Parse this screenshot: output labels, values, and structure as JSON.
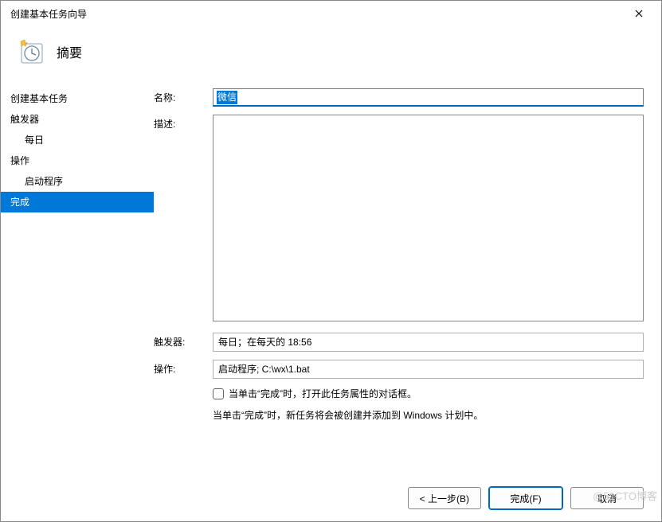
{
  "window": {
    "title": "创建基本任务向导"
  },
  "header": {
    "title": "摘要"
  },
  "sidebar": {
    "items": [
      {
        "label": "创建基本任务",
        "sub": false,
        "selected": false
      },
      {
        "label": "触发器",
        "sub": false,
        "selected": false
      },
      {
        "label": "每日",
        "sub": true,
        "selected": false
      },
      {
        "label": "操作",
        "sub": false,
        "selected": false
      },
      {
        "label": "启动程序",
        "sub": true,
        "selected": false
      },
      {
        "label": "完成",
        "sub": false,
        "selected": true
      }
    ]
  },
  "form": {
    "name_label": "名称:",
    "name_value": "微信",
    "desc_label": "描述:",
    "desc_value": "",
    "trigger_label": "触发器:",
    "trigger_value": "每日；在每天的 18:56",
    "action_label": "操作:",
    "action_value": "启动程序; C:\\wx\\1.bat",
    "checkbox_label": "当单击“完成”时，打开此任务属性的对话框。",
    "info_label": "当单击“完成”时，新任务将会被创建并添加到 Windows 计划中。"
  },
  "footer": {
    "back": "< 上一步(B)",
    "finish": "完成(F)",
    "cancel": "取消"
  },
  "watermark": "@51CTO博客"
}
